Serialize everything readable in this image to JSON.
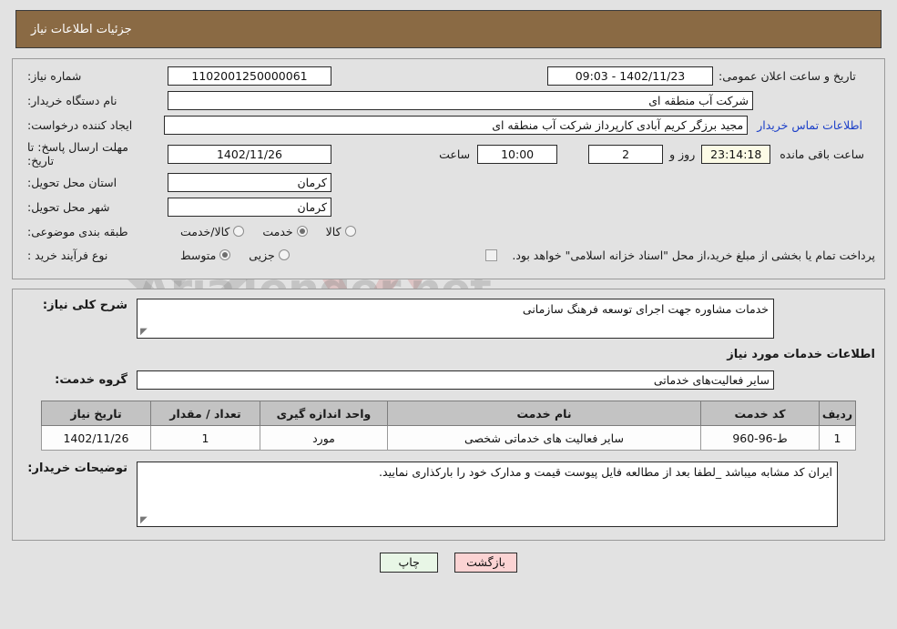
{
  "header": {
    "title": "جزئیات اطلاعات نیاز",
    "bg_color": "#8a6a44",
    "text_color": "#ffffff"
  },
  "form": {
    "need_number_label": "شماره نیاز:",
    "need_number_value": "1102001250000061",
    "public_announce_label": "تاریخ و ساعت اعلان عمومی:",
    "public_announce_value": "1402/11/23 - 09:03",
    "buyer_org_label": "نام دستگاه خریدار:",
    "buyer_org_value": "شرکت آب منطقه ای",
    "requester_label": "ایجاد کننده درخواست:",
    "requester_value": "مجید  برزگر کریم آبادی کارپرداز شرکت آب منطقه ای",
    "buyer_contact_link": "اطلاعات تماس خریدار",
    "deadline_label": "مهلت ارسال پاسخ: تا تاریخ:",
    "deadline_date": "1402/11/26",
    "hour_label": "ساعت",
    "deadline_time": "10:00",
    "remaining_days": "2",
    "days_and_label": "روز و",
    "remaining_time": "23:14:18",
    "remaining_suffix": "ساعت باقی مانده",
    "province_label": "استان محل تحویل:",
    "province_value": "کرمان",
    "city_label": "شهر محل تحویل:",
    "city_value": "کرمان",
    "category_label": "طبقه بندی موضوعی:",
    "category_options": [
      {
        "label": "کالا",
        "selected": false
      },
      {
        "label": "خدمت",
        "selected": true
      },
      {
        "label": "کالا/خدمت",
        "selected": false
      }
    ],
    "process_label": "نوع فرآیند خرید :",
    "process_options": [
      {
        "label": "جزیی",
        "selected": false
      },
      {
        "label": "متوسط",
        "selected": true
      }
    ],
    "treasury_checkbox_checked": false,
    "treasury_text": "پرداخت تمام یا بخشی از مبلغ خرید،از محل \"اسناد خزانه اسلامی\" خواهد بود."
  },
  "description": {
    "label": "شرح کلی نیاز:",
    "value": "خدمات مشاوره جهت اجرای توسعه فرهنگ سازمانی"
  },
  "services": {
    "section_title": "اطلاعات خدمات مورد نیاز",
    "group_label": "گروه خدمت:",
    "group_value": "سایر فعالیت‌های خدماتی",
    "table": {
      "columns": [
        "ردیف",
        "کد خدمت",
        "نام خدمت",
        "واحد اندازه گیری",
        "تعداد / مقدار",
        "تاریخ نیاز"
      ],
      "rows": [
        [
          "1",
          "ط-96-960",
          "سایر فعالیت های خدماتی شخصی",
          "مورد",
          "1",
          "1402/11/26"
        ]
      ]
    }
  },
  "buyer_notes": {
    "label": "توضیحات خریدار:",
    "value": "ایران کد مشابه میباشد _لطفا بعد از مطالعه فایل پیوست قیمت و مدارک خود را بارکذاری نمایید."
  },
  "footer": {
    "print_label": "چاپ",
    "back_label": "بازگشت",
    "print_color": "#e8f6e6",
    "back_color": "#fbd3d3"
  },
  "watermark": {
    "text": "AriaTender.net"
  }
}
